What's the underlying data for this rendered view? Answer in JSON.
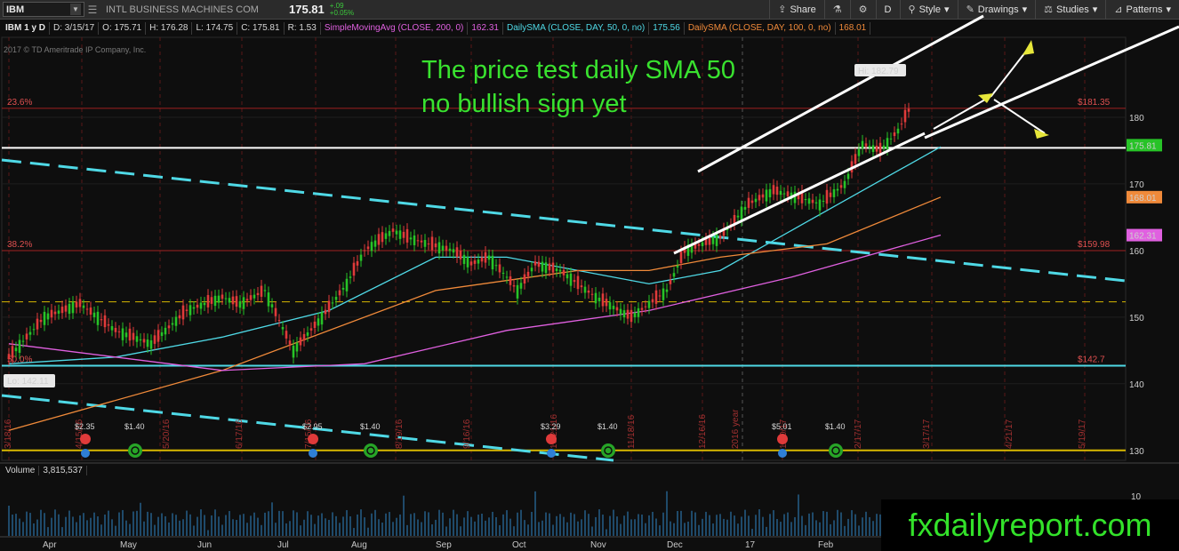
{
  "toolbar": {
    "symbol": "IBM",
    "company": "INTL BUSINESS MACHINES COM",
    "last": "175.81",
    "change": "+.09",
    "change_pct": "+0.05%",
    "buttons": [
      {
        "label": "Share",
        "icon": "share-icon"
      },
      {
        "label": "",
        "icon": "flask-icon"
      },
      {
        "label": "",
        "icon": "gear-icon"
      },
      {
        "label": "D",
        "icon": ""
      },
      {
        "label": "Style",
        "icon": "style-icon"
      },
      {
        "label": "Drawings",
        "icon": "pencil-icon"
      },
      {
        "label": "Studies",
        "icon": "studies-icon"
      },
      {
        "label": "Patterns",
        "icon": "patterns-icon"
      }
    ]
  },
  "header": {
    "symbol_period": "IBM 1 y D",
    "date": "D: 3/15/17",
    "open": "O: 175.71",
    "high": "H: 176.28",
    "low": "L: 174.75",
    "close": "C: 175.81",
    "range": "R: 1.53",
    "sma200_label": "SimpleMovingAvg (CLOSE, 200, 0)",
    "sma200_value": "162.31",
    "sma50_label": "DailySMA (CLOSE, DAY, 50, 0, no)",
    "sma50_value": "175.56",
    "sma100_label": "DailySMA (CLOSE, DAY, 100, 0, no)",
    "sma100_value": "168.01",
    "copyright": "2017 © TD Ameritrade IP Company, Inc."
  },
  "annotation": {
    "line1": "The price test daily SMA 50",
    "line2": "no bullish sign yet"
  },
  "watermark": "fxdailyreport.com",
  "volume": {
    "label": "Volume",
    "value": "3,815,537",
    "axis_top": "10"
  },
  "chart_data": {
    "type": "line",
    "y_ticks": [
      130,
      140,
      150,
      160,
      170,
      180
    ],
    "ylim": [
      128.5,
      192
    ],
    "x_month_labels": [
      "Apr",
      "May",
      "Jun",
      "Jul",
      "Aug",
      "Sep",
      "Oct",
      "Nov",
      "Dec",
      "17",
      "Feb"
    ],
    "series": [
      {
        "name": "Close",
        "color": "#27c327",
        "x": [
          0,
          10,
          20,
          30,
          40,
          50,
          60,
          65,
          72,
          80,
          88,
          95,
          100,
          108,
          112,
          118,
          125,
          130,
          135,
          140,
          143,
          148,
          155,
          165,
          175,
          180,
          185,
          190,
          200,
          208,
          215,
          222,
          228,
          235,
          240,
          245,
          250,
          254
        ],
        "values": [
          144,
          150,
          152,
          148,
          146,
          151,
          153,
          152,
          154,
          145,
          150,
          155,
          160,
          163,
          162,
          161,
          160,
          158,
          159,
          156,
          154,
          158,
          157,
          153,
          150,
          152,
          154,
          160,
          162,
          167,
          169,
          168,
          167,
          170,
          176,
          175,
          178,
          182
        ]
      },
      {
        "name": "",
        "color": "#4fd9e6",
        "x": [
          0,
          30,
          60,
          90,
          120,
          140,
          160,
          180,
          200,
          220,
          240,
          262
        ],
        "values": [
          143,
          144,
          147,
          151,
          159,
          159,
          157,
          155,
          157,
          163,
          169,
          175.56
        ]
      },
      {
        "name": "",
        "color": "#f08a3a",
        "x": [
          0,
          60,
          120,
          160,
          180,
          200,
          230,
          262
        ],
        "values": [
          133,
          142,
          154,
          157,
          157,
          159,
          161,
          168.01
        ]
      },
      {
        "name": "",
        "color": "#e060e0",
        "x": [
          0,
          60,
          100,
          140,
          180,
          220,
          262
        ],
        "values": [
          146,
          142,
          143,
          148,
          151,
          156,
          162.31
        ]
      }
    ],
    "price_labels": [
      {
        "text": "175.81",
        "value": 175.81,
        "bg": "#27c327",
        "color": "#000000"
      },
      {
        "text": "168.01",
        "value": 168.01,
        "bg": "#f08a3a",
        "color": "#000000"
      },
      {
        "text": "162.31",
        "value": 162.31,
        "bg": "#e060e0",
        "color": "#000000"
      }
    ],
    "hi_label": "Hi: 182.79",
    "lo_label": "Lo: 142.11",
    "fib_levels": [
      {
        "pct": "23.6%",
        "value": 181.35,
        "label": "$181.35"
      },
      {
        "pct": "38.2%",
        "value": 159.98,
        "label": "$159.98"
      },
      {
        "pct": "50.0%",
        "value": 142.7,
        "label": "$142.7"
      }
    ],
    "vertical_date_labels": [
      "3/18/16",
      "4/15/16",
      "5/20/16",
      "6/17/16",
      "7/15/16",
      "8/19/16",
      "9/16/16",
      "10/21/16",
      "11/18/16",
      "12/16/16",
      "2016 year",
      "1/20/17",
      "2/17/17",
      "3/17/17",
      "4/21/17",
      "5/19/17"
    ],
    "dividends": [
      "$2.35",
      "$1.40",
      "$2.95",
      "$1.40",
      "$3.29",
      "$1.40",
      "$5.01",
      "$1.40"
    ]
  }
}
